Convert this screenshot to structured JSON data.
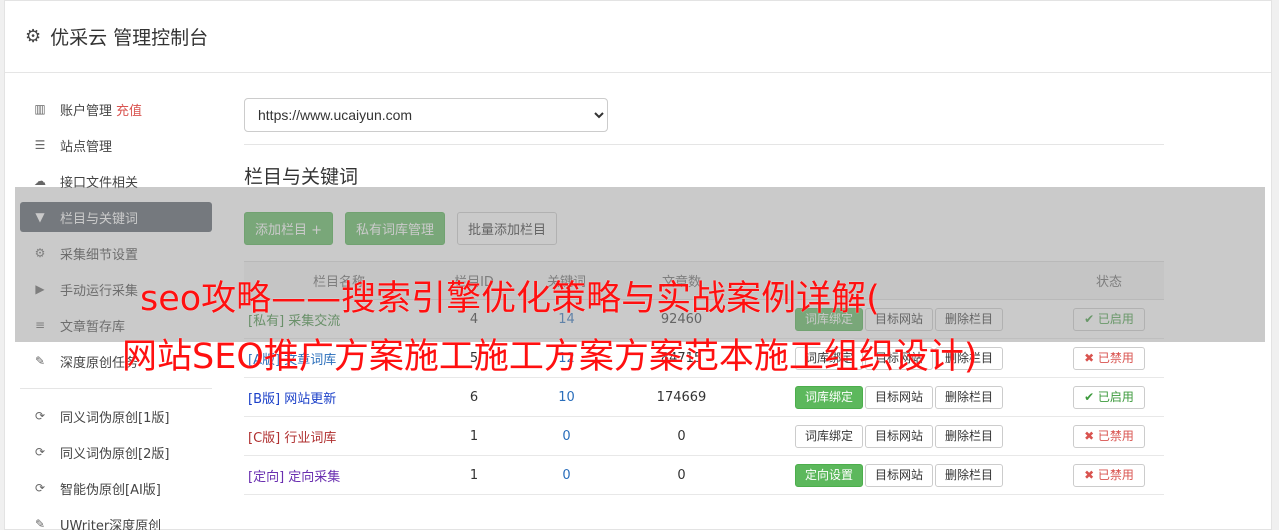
{
  "header": {
    "title": "优采云 管理控制台",
    "icon": "gear-icon"
  },
  "sidebar": {
    "items": [
      {
        "label": "账户管理",
        "hint": "充值",
        "icon": "bar-chart-icon",
        "glyph": "▥"
      },
      {
        "label": "站点管理",
        "icon": "server-icon",
        "glyph": "☰"
      },
      {
        "label": "接口文件相关",
        "icon": "cloud-download-icon",
        "glyph": "☁"
      },
      {
        "label": "栏目与关键词",
        "icon": "filter-icon",
        "glyph": "▼",
        "active": true
      },
      {
        "label": "采集细节设置",
        "icon": "cogs-icon",
        "glyph": "⚙"
      },
      {
        "label": "手动运行采集",
        "icon": "play-circle-icon",
        "glyph": "▶"
      },
      {
        "label": "文章暂存库",
        "icon": "database-icon",
        "glyph": "≡"
      },
      {
        "label": "深度原创任务",
        "icon": "edit-icon",
        "glyph": "✎"
      }
    ],
    "items2": [
      {
        "label": "同义词伪原创[1版]",
        "icon": "refresh-icon",
        "glyph": "⟳"
      },
      {
        "label": "同义词伪原创[2版]",
        "icon": "refresh-icon",
        "glyph": "⟳"
      },
      {
        "label": "智能伪原创[AI版]",
        "icon": "refresh-icon",
        "glyph": "⟳"
      },
      {
        "label": "UWriter深度原创",
        "icon": "edit-icon",
        "glyph": "✎"
      }
    ]
  },
  "main": {
    "site_select": "https://www.ucaiyun.com",
    "section_title": "栏目与关键词",
    "buttons": {
      "add": "添加栏目 +",
      "private": "私有词库管理",
      "batch": "批量添加栏目"
    },
    "table": {
      "headers": [
        "栏目名称",
        "栏目ID",
        "关键词",
        "文章数",
        "",
        "状态"
      ],
      "rows": [
        {
          "tag": "[私有]",
          "name": "采集交流",
          "id": "4",
          "kw": "14",
          "count": "92460",
          "first_btn": "词库绑定",
          "first_green": true,
          "status": "✔ 已启用",
          "on": true,
          "color": "#3c8a3c"
        },
        {
          "tag": "[A版]",
          "name": "文章词库",
          "id": "5",
          "kw": "12",
          "count": "84715",
          "first_btn": "词库绑定",
          "first_green": false,
          "status": "✖ 已禁用",
          "on": false,
          "color": "#2a6ebb"
        },
        {
          "tag": "[B版]",
          "name": "网站更新",
          "id": "6",
          "kw": "10",
          "count": "174669",
          "first_btn": "词库绑定",
          "first_green": true,
          "status": "✔ 已启用",
          "on": true,
          "color": "#1a3fc8"
        },
        {
          "tag": "[C版]",
          "name": "行业词库",
          "id": "1",
          "kw": "0",
          "count": "0",
          "first_btn": "词库绑定",
          "first_green": false,
          "status": "✖ 已禁用",
          "on": false,
          "color": "#b03030"
        },
        {
          "tag": "[定向]",
          "name": "定向采集",
          "id": "1",
          "kw": "0",
          "count": "0",
          "first_btn": "定向设置",
          "first_green": true,
          "status": "✖ 已禁用",
          "on": false,
          "color": "#6a2fb0"
        }
      ],
      "row_buttons": {
        "site": "目标网站",
        "delete": "删除栏目"
      }
    }
  },
  "overlay": {
    "line1": "seo攻略——搜索引擎优化策略与实战案例详解(",
    "line2": "网站SEO推广方案施工施工方案方案范本施工组织设计)"
  }
}
